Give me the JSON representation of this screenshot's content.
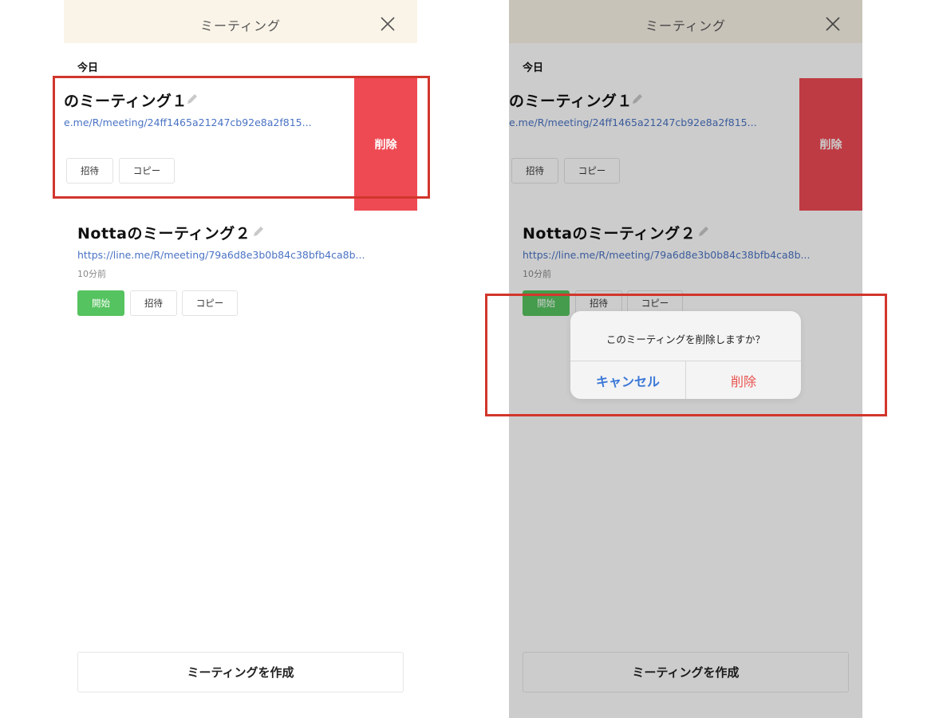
{
  "header": {
    "title": "ミーティング"
  },
  "section": {
    "label": "今日"
  },
  "meetings": [
    {
      "title_visible": "のミーティング１",
      "url_visible": "e.me/R/meeting/24ff1465a21247cb92e8a2f815...",
      "invite_label": "招待",
      "copy_label": "コピー"
    },
    {
      "title": "Nottaのミーティング２",
      "url": "https://line.me/R/meeting/79a6d8e3b0b84c38bfb4ca8b...",
      "time": "10分前",
      "start_label": "開始",
      "invite_label": "招待",
      "copy_label": "コピー"
    }
  ],
  "swipe_action": {
    "delete_label": "削除"
  },
  "create_button": {
    "label": "ミーティングを作成"
  },
  "dialog": {
    "message": "このミーティングを削除しますか？",
    "cancel_label": "キャンセル",
    "delete_label": "削除"
  },
  "colors": {
    "header_bg": "#faf4e8",
    "delete_red": "#ee4a54",
    "start_green": "#55c35f",
    "link_blue": "#4a73c4",
    "highlight_red": "#d2362c",
    "cancel_blue": "#3b78d8"
  }
}
